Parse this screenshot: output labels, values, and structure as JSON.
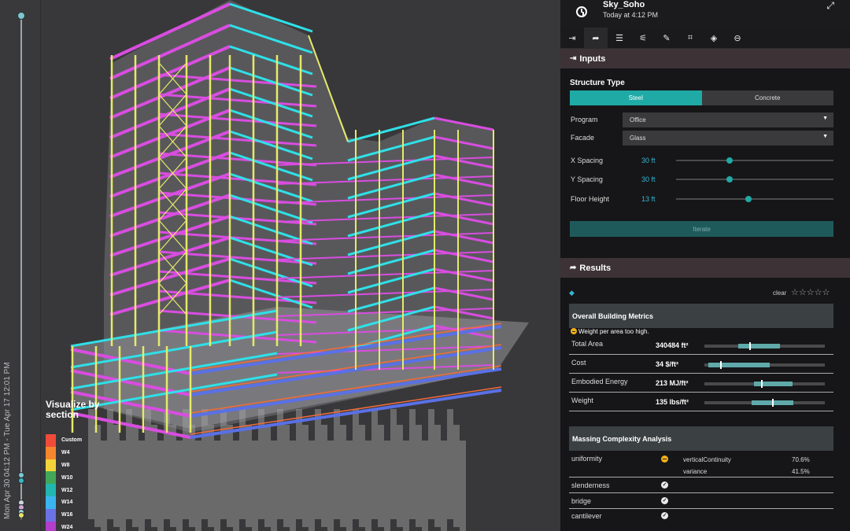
{
  "timeline": {
    "range_label": "Mon Apr 30 04:12 PM - Tue Apr 17 12:01 PM",
    "dot_colors": [
      "#7ec7cf",
      "#38b6c8",
      "#cfd6da",
      "#d9a6d8",
      "#9fd3da",
      "#e9e36a"
    ]
  },
  "legend": {
    "title": "Visualize by section",
    "items": [
      {
        "label": "Custom",
        "color": "#f04b3a"
      },
      {
        "label": "W4",
        "color": "#f5862e"
      },
      {
        "label": "W8",
        "color": "#f2d43a"
      },
      {
        "label": "W10",
        "color": "#41a85a"
      },
      {
        "label": "W12",
        "color": "#21b7b0"
      },
      {
        "label": "W14",
        "color": "#3ab5f0"
      },
      {
        "label": "W16",
        "color": "#6b72e3"
      },
      {
        "label": "W24",
        "color": "#b33ec9"
      }
    ]
  },
  "header": {
    "project_name": "Sky_Soho",
    "time": "Today at 4:12 PM",
    "icons": [
      "clock-icon",
      "expand-icon"
    ]
  },
  "toolbar": {
    "buttons": [
      "sign-in-icon",
      "sign-out-icon",
      "list-icon",
      "sliders-icon",
      "brush-icon",
      "crop-icon",
      "cube-icon",
      "search-minus-icon"
    ]
  },
  "inputs": {
    "section_title": "Inputs",
    "structure_type_label": "Structure Type",
    "structure_options": [
      "Steel",
      "Concrete"
    ],
    "selected_structure": "Steel",
    "program_label": "Program",
    "program_value": "Office",
    "facade_label": "Facade",
    "facade_value": "Glass",
    "sliders": [
      {
        "label": "X Spacing",
        "value": "30 ft",
        "position": 0.34
      },
      {
        "label": "Y Spacing",
        "value": "30 ft",
        "position": 0.34
      },
      {
        "label": "Floor Height",
        "value": "13 ft",
        "position": 0.46
      }
    ],
    "iterate_label": "Iterate"
  },
  "results": {
    "section_title": "Results",
    "clear_label": "clear",
    "stars": "☆☆☆☆☆",
    "overall_title": "Overall Building Metrics",
    "warning": "Weight per area too high.",
    "metrics": [
      {
        "label": "Total Area",
        "value": "340484 ft²",
        "range": [
          0.28,
          0.63
        ],
        "marker": 0.37
      },
      {
        "label": "Cost",
        "value": "34 $/ft²",
        "range": [
          0.03,
          0.54
        ],
        "marker": 0.13
      },
      {
        "label": "Embodied Energy",
        "value": "213 MJ/ft²",
        "range": [
          0.41,
          0.73
        ],
        "marker": 0.47
      },
      {
        "label": "Weight",
        "value": "135 lbs/ft²",
        "range": [
          0.39,
          0.74
        ],
        "marker": 0.56
      }
    ],
    "massing_title": "Massing Complexity Analysis",
    "massing": [
      {
        "label": "uniformity",
        "status": "warning",
        "details": [
          {
            "name": "verticalContinuity",
            "value": "70.6%"
          },
          {
            "name": "variance",
            "value": "41.5%"
          }
        ]
      },
      {
        "label": "slenderness",
        "status": "ok",
        "details": []
      },
      {
        "label": "bridge",
        "status": "ok",
        "details": []
      },
      {
        "label": "cantilever",
        "status": "ok",
        "details": []
      }
    ]
  }
}
